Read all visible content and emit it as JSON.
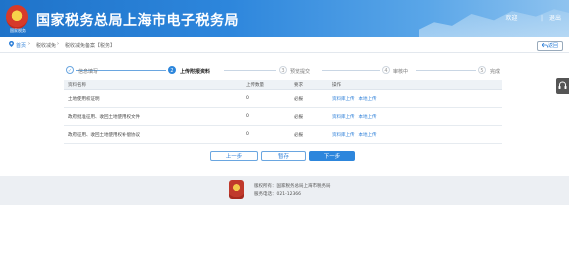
{
  "header": {
    "logo_text": "国家税务",
    "title": "国家税务总局上海市电子税务局",
    "welcome": "欢迎",
    "user": "      ",
    "sep": "|",
    "logout": "退出"
  },
  "breadcrumb": {
    "home": "首页",
    "sep1": "›",
    "item2": "税收减免",
    "sep2": "›",
    "item3": "税收减免备案【税务】"
  },
  "back_label": "返回",
  "stepper": {
    "steps": [
      {
        "num": "✓",
        "label": "信息填写",
        "state": "done"
      },
      {
        "num": "2",
        "label": "上传附报资料",
        "state": "active"
      },
      {
        "num": "3",
        "label": "预览提交",
        "state": "todo"
      },
      {
        "num": "4",
        "label": "审核中",
        "state": "todo"
      },
      {
        "num": "5",
        "label": "完成",
        "state": "todo"
      }
    ]
  },
  "table": {
    "headers": [
      "资料名称",
      "上传数量",
      "要求",
      "操作"
    ],
    "rows": [
      {
        "name": "土地使用权证明",
        "count": "0",
        "req": "必报",
        "op1": "资料库上传",
        "op2": "本地上传"
      },
      {
        "name": "政府批准征用、收回土地使用权文件",
        "count": "0",
        "req": "必报",
        "op1": "资料库上传",
        "op2": "本地上传"
      },
      {
        "name": "政府征用、收回土地使用权补偿协议",
        "count": "0",
        "req": "必报",
        "op1": "资料库上传",
        "op2": "本地上传"
      }
    ]
  },
  "buttons": {
    "prev": "上一步",
    "save": "暂存",
    "next": "下一步"
  },
  "footer": {
    "line1": "版权所有：国家税务总局上海市税务局",
    "line2": "服务电话：021-12366"
  }
}
